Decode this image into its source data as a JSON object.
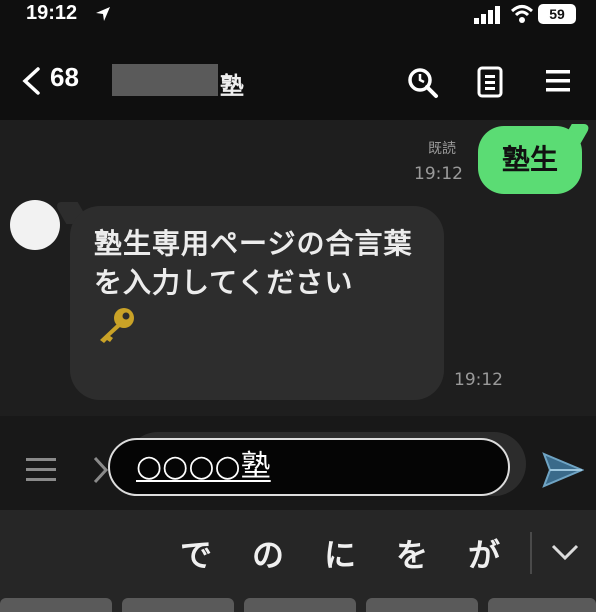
{
  "status_bar": {
    "time": "19:12",
    "battery": "59",
    "icons": [
      "location-arrow-icon",
      "signal-icon",
      "wifi-icon",
      "battery-icon"
    ]
  },
  "header": {
    "back_count": "68",
    "title": "塾",
    "icons": [
      "search-icon",
      "notes-icon",
      "menu-icon"
    ]
  },
  "chat": {
    "outgoing": {
      "text": "塾生",
      "read_label": "既読",
      "time": "19:12"
    },
    "incoming": {
      "text": "塾生専用ページの合言葉を入力してください",
      "emoji": "key-icon",
      "time": "19:12"
    }
  },
  "composer": {
    "input_value": "○○○○塾"
  },
  "keyboard": {
    "suggestions": [
      "で",
      "の",
      "に",
      "を",
      "が"
    ]
  },
  "colors": {
    "outgoing_bubble": "#5bdc74",
    "incoming_bubble": "#2d2d2d",
    "background": "#1e1e1e"
  }
}
